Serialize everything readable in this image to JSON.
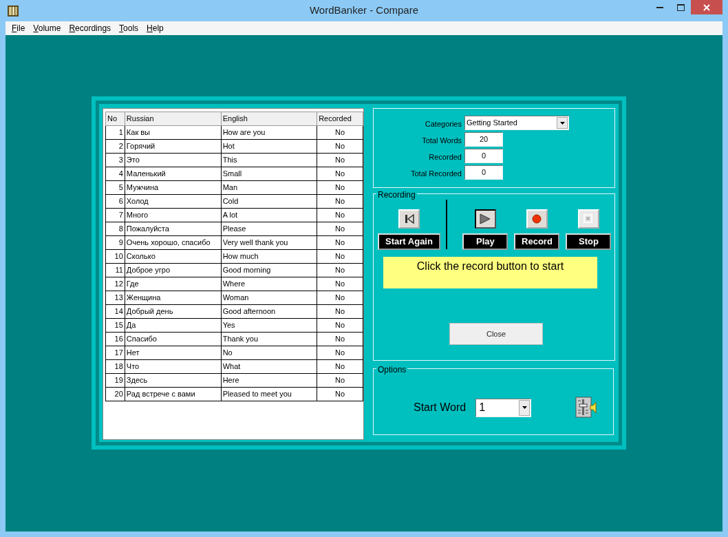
{
  "window": {
    "title": "WordBanker - Compare"
  },
  "menu": [
    {
      "label": "File"
    },
    {
      "label": "Volume"
    },
    {
      "label": "Recordings"
    },
    {
      "label": "Tools"
    },
    {
      "label": "Help"
    }
  ],
  "table": {
    "columns": [
      "No",
      "Russian",
      "English",
      "Recorded"
    ],
    "rows": [
      [
        "1",
        "Как вы",
        "How are you",
        "No"
      ],
      [
        "2",
        "Горячий",
        "Hot",
        "No"
      ],
      [
        "3",
        "Это",
        "This",
        "No"
      ],
      [
        "4",
        "Маленький",
        "Small",
        "No"
      ],
      [
        "5",
        "Мужчина",
        "Man",
        "No"
      ],
      [
        "6",
        "Холод",
        "Cold",
        "No"
      ],
      [
        "7",
        "Много",
        "A lot",
        "No"
      ],
      [
        "8",
        "Пожалуйста",
        "Please",
        "No"
      ],
      [
        "9",
        "Очень хорошо, спасибо",
        "Very well thank you",
        "No"
      ],
      [
        "10",
        "Сколько",
        "How much",
        "No"
      ],
      [
        "11",
        "Доброе угро",
        "Good morning",
        "No"
      ],
      [
        "12",
        "Где",
        "Where",
        "No"
      ],
      [
        "13",
        "Женщина",
        "Woman",
        "No"
      ],
      [
        "14",
        "Добрый день",
        "Good afternoon",
        "No"
      ],
      [
        "15",
        "Да",
        "Yes",
        "No"
      ],
      [
        "16",
        "Спасибо",
        "Thank you",
        "No"
      ],
      [
        "17",
        "Нет",
        "No",
        "No"
      ],
      [
        "18",
        "Что",
        "What",
        "No"
      ],
      [
        "19",
        "Здесь",
        "Here",
        "No"
      ],
      [
        "20",
        "Рад встрече с вами",
        "Pleased to meet you",
        "No"
      ]
    ]
  },
  "summary": {
    "categories_label": "Categories",
    "category": "Getting Started",
    "stats": [
      {
        "label": "Total Words",
        "value": "20"
      },
      {
        "label": "Recorded",
        "value": "0"
      },
      {
        "label": "Total Recorded",
        "value": "0"
      }
    ]
  },
  "recording": {
    "title": "Recording",
    "controls": [
      {
        "kind": "restart",
        "label": "Start Again",
        "pressed": false,
        "disabled": false
      },
      {
        "kind": "play",
        "label": "Play",
        "pressed": true,
        "disabled": false
      },
      {
        "kind": "record",
        "label": "Record",
        "pressed": false,
        "disabled": false
      },
      {
        "kind": "stop",
        "label": "Stop",
        "pressed": false,
        "disabled": true
      }
    ],
    "message": "Click the record button to start",
    "close": "Close"
  },
  "options": {
    "title": "Options",
    "start_word_label": "Start Word",
    "start_word": "1"
  }
}
